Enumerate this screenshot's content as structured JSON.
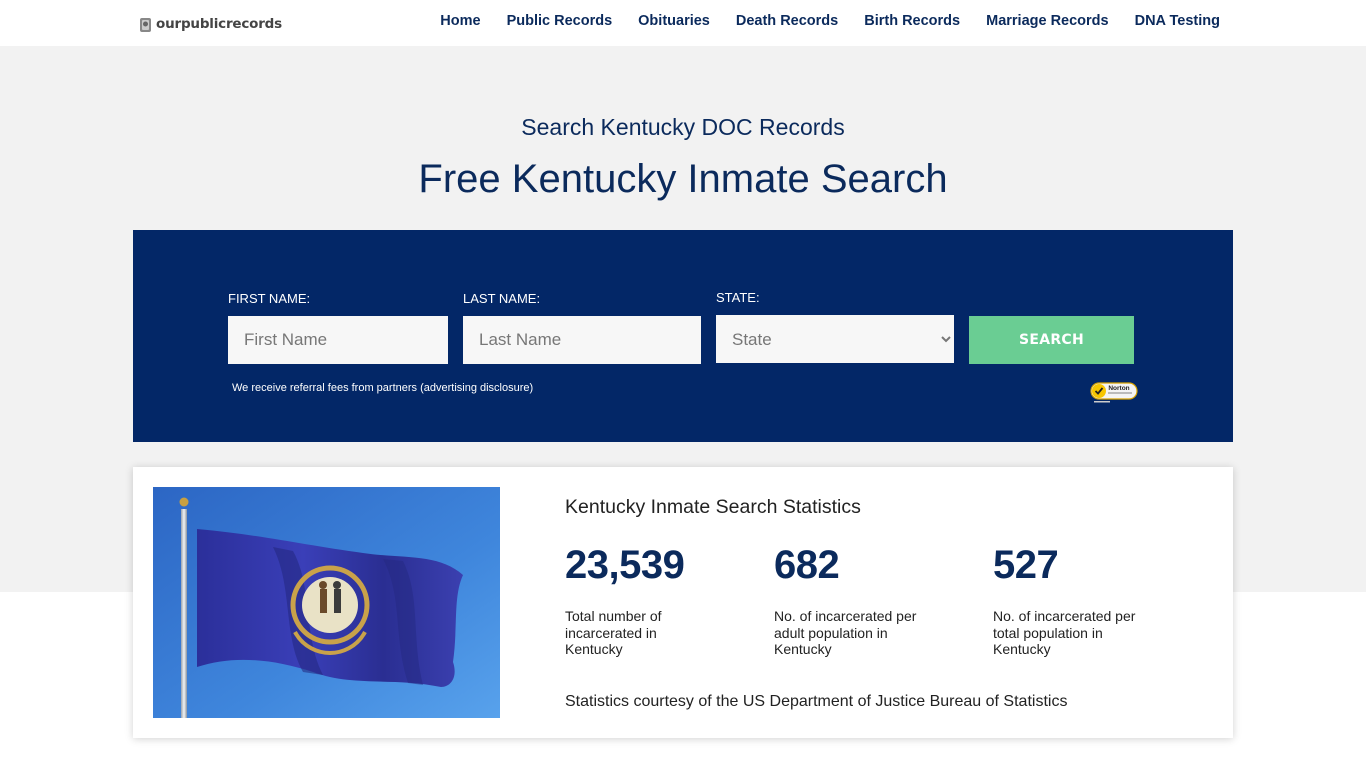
{
  "header": {
    "logo_text": "ourpublicrecords",
    "nav": [
      "Home",
      "Public Records",
      "Obituaries",
      "Death Records",
      "Birth Records",
      "Marriage Records",
      "DNA Testing"
    ]
  },
  "hero": {
    "subtitle": "Search Kentucky DOC Records",
    "title": "Free Kentucky Inmate Search"
  },
  "search_form": {
    "first_name_label": "FIRST NAME:",
    "first_name_placeholder": "First Name",
    "last_name_label": "LAST NAME:",
    "last_name_placeholder": "Last Name",
    "state_label": "STATE:",
    "state_selected": "State",
    "search_button": "SEARCH",
    "disclosure": "We receive referral fees from partners (advertising disclosure)",
    "badge_text": "Norton"
  },
  "stats": {
    "title": "Kentucky Inmate Search Statistics",
    "items": [
      {
        "value": "23,539",
        "desc": "Total number of incarcerated in Kentucky"
      },
      {
        "value": "682",
        "desc": "No. of incarcerated per adult population in Kentucky"
      },
      {
        "value": "527",
        "desc": "No. of incarcerated per total population in Kentucky"
      }
    ],
    "footer": "Statistics courtesy of the US Department of Justice Bureau of Statistics"
  },
  "colors": {
    "navy": "#032767",
    "heading": "#0b2a5c",
    "button": "#6acd93",
    "hero_bg": "#f2f2f2"
  }
}
